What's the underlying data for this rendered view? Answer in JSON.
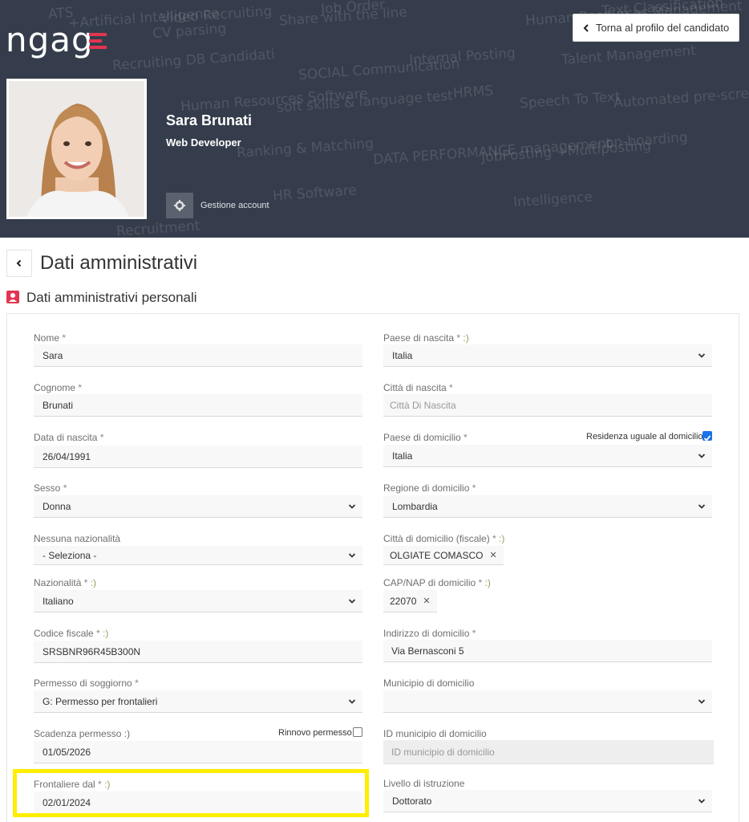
{
  "app": {
    "logo_text": "ngag",
    "back_to_profile": "Torna al profilo del candidato"
  },
  "header": {
    "candidate_name": "Sara Brunati",
    "candidate_role": "Web Developer",
    "account_label": "Gestione account",
    "background_words": [
      "ATS",
      "+Artificial Intelligence",
      "Video Recruiting",
      "CV parsing",
      "Share with the line",
      "Job Order",
      "Human Resources Management",
      "Text Classification",
      "Recruiting DB Candidati",
      "SOCIAL Communication",
      "Internal Posting",
      "Talent Management",
      "Human Resources Software",
      "soft skills & language test",
      "HRMS",
      "Speech To Text",
      "Automated pre-screening",
      "Ranking & Matching",
      "DATA PERFORMANCE management",
      "JobPosting +Multiposting",
      "on-boarding",
      "Recruitment",
      "HR Software",
      "Intelligence"
    ]
  },
  "section": {
    "title": "Dati amministrativi",
    "subtitle": "Dati amministrativi personali"
  },
  "colors": {
    "header_bg": "#353d4c",
    "accent": "#e23551",
    "checkbox_checked": "#1a73e8",
    "highlight": "#ffee00"
  },
  "form": {
    "nome": {
      "label": "Nome",
      "req": " *",
      "value": "Sara"
    },
    "cognome": {
      "label": "Cognome",
      "req": " *",
      "value": "Brunati"
    },
    "data_nascita": {
      "label": "Data di nascita",
      "req": " *",
      "value": "26/04/1991"
    },
    "sesso": {
      "label": "Sesso",
      "req": " *",
      "value": "Donna"
    },
    "nessuna_nazionalita": {
      "label": "Nessuna nazionalità",
      "value": "- Seleziona -"
    },
    "nazionalita": {
      "label": "Nazionalità",
      "req": " *",
      "hint": " :)",
      "value": "Italiano"
    },
    "codice_fiscale": {
      "label": "Codice fiscale",
      "req": " *",
      "hint": " :)",
      "value": "SRSBNR96R45B300N"
    },
    "permesso": {
      "label": "Permesso di soggiorno",
      "req": " *",
      "value": "G: Permesso per frontalieri"
    },
    "scadenza": {
      "label": "Scadenza permesso",
      "hint": " :)",
      "value": "01/05/2026",
      "rinnovo_label": "Rinnovo permesso",
      "rinnovo_checked": false
    },
    "frontaliere": {
      "label": "Frontaliere dal",
      "req": " *",
      "hint": " :)",
      "value": "02/01/2024"
    },
    "paese_nascita": {
      "label": "Paese di nascita",
      "req": " *",
      "hint": " :)",
      "value": "Italia"
    },
    "citta_nascita": {
      "label": "Città di nascita",
      "req": " *",
      "placeholder": "Città Di Nascita"
    },
    "paese_domicilio": {
      "label": "Paese di domicilio",
      "req": " *",
      "value": "Italia",
      "residenza_label": "Residenza uguale al domicilio",
      "residenza_checked": true
    },
    "regione_domicilio": {
      "label": "Regione di domicilio",
      "req": " *",
      "value": "Lombardia"
    },
    "citta_domicilio": {
      "label": "Città di domicilio (fiscale)",
      "req": " *",
      "hint": " :)",
      "tag": "OLGIATE COMASCO"
    },
    "cap_domicilio": {
      "label": "CAP/NAP di domicilio",
      "req": " *",
      "hint": " :)",
      "tag": "22070"
    },
    "indirizzo_domicilio": {
      "label": "Indirizzo di domicilio",
      "req": " *",
      "value": "Via Bernasconi 5"
    },
    "municipio_domicilio": {
      "label": "Municipio di domicilio",
      "value": ""
    },
    "id_municipio": {
      "label": "ID municipio di domicilio",
      "placeholder": "ID municipio di domicilio"
    },
    "livello_istruzione": {
      "label": "Livello di istruzione",
      "value": "Dottorato"
    }
  },
  "icons": {
    "back": "chevron-left-icon",
    "gear": "gear-icon",
    "person": "person-badge-icon",
    "dropdown": "chevron-down-icon",
    "remove": "close-icon"
  }
}
